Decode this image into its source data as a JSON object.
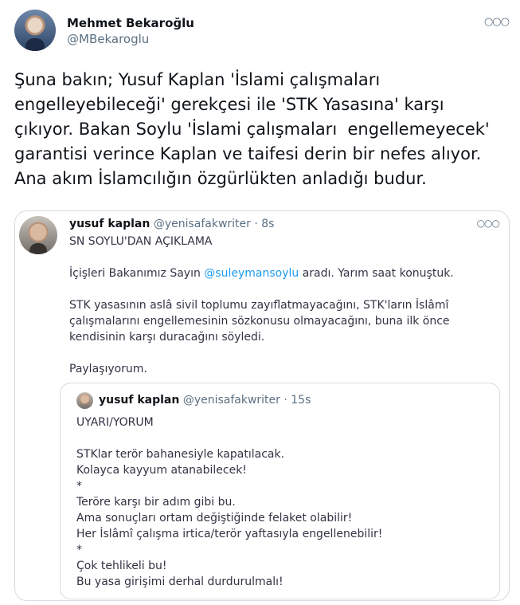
{
  "author": {
    "name": "Mehmet Bekaroğlu",
    "handle": "@MBekaroglu"
  },
  "tweet_text": "Şuna bakın; Yusuf Kaplan 'İslami çalışmaları engelleyebileceği' gerekçesi ile 'STK Yasasına' karşı çıkıyor. Bakan Soylu 'İslami çalışmaları  engellemeyecek' garantisi verince Kaplan ve taifesi derin bir nefes alıyor. Ana akım İslamcılığın özgürlükten anladığı budur.",
  "quoted_tweet": {
    "name": "yusuf kaplan",
    "handle": "@yenisafakwriter",
    "time": "· 8s",
    "title": "SN SOYLU'DAN AÇIKLAMA",
    "line1_before": "İçişleri Bakanımız Sayın ",
    "mention": "@suleymansoylu",
    "line1_after": " aradı. Yarım saat konuştuk.",
    "paragraph2": "STK yasasının aslâ sivil toplumu zayıflatmayacağını, STK'ların İslâmî çalışmalarını engellemesinin sözkonusu olmayacağını, buna ilk önce kendisinin karşı duracağını söyledi.",
    "paragraph3": "Paylaşıyorum."
  },
  "inner_quoted_tweet": {
    "name": "yusuf kaplan",
    "handle": "@yenisafakwriter",
    "time": "· 15s",
    "text": "UYARI/YORUM\n\nSTKlar terör bahanesiyle kapatılacak.\nKolayca kayyum atanabilecek!\n*\nTeröre karşı bir adım gibi bu.\nAma sonuçları ortam değiştiğinde felaket olabilir!\nHer İslâmî çalışma irtica/terör yaftasıyla engellenebilir!\n*\nÇok tehlikeli bu!\nBu yasa girişimi derhal durdurulmalı!"
  }
}
